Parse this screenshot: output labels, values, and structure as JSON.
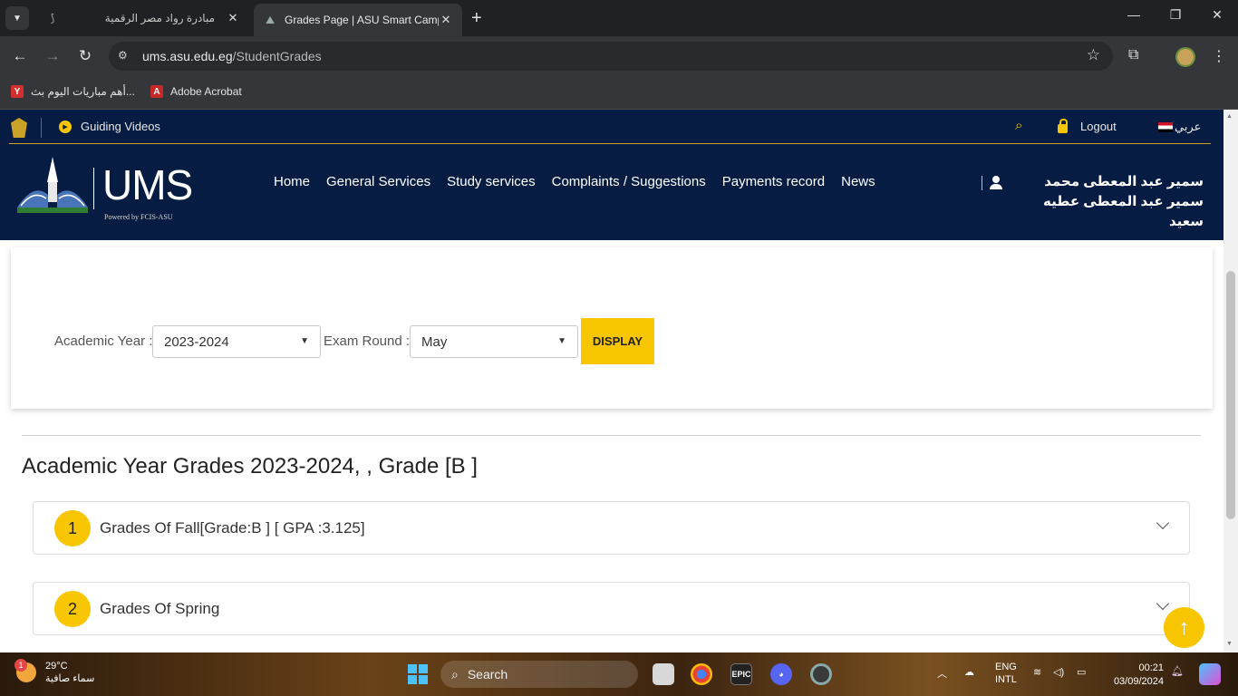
{
  "browser": {
    "tabs": [
      {
        "title": "مبادرة رواد مصر الرقمية",
        "active": false
      },
      {
        "title": "Grades Page | ASU Smart Camp",
        "active": true
      }
    ],
    "url_host": "ums.asu.edu.eg",
    "url_path": "/StudentGrades",
    "bookmarks": [
      {
        "label": "أهم مباريات اليوم بث...",
        "icon": "yalla-icon",
        "color": "#d32f2f"
      },
      {
        "label": "Adobe Acrobat",
        "icon": "acrobat-icon",
        "color": "#d32f2f"
      }
    ]
  },
  "site": {
    "guiding_videos": "Guiding Videos",
    "logout": "Logout",
    "language": "عربي",
    "logo_text": "UMS",
    "logo_powered": "Powered by FCIS-ASU",
    "nav": [
      "Home",
      "General Services",
      "Study services",
      "Complaints / Suggestions",
      "Payments record",
      "News"
    ],
    "user_name": "سمير عبد المعطى محمد سمير عبد المعطى عطيه سعيد"
  },
  "filters": {
    "academic_year_label": "Academic Year :",
    "academic_year_value": "2023-2024",
    "exam_round_label": "Exam Round :",
    "exam_round_value": "May",
    "display_button": "DISPLAY"
  },
  "results": {
    "title": "Academic Year Grades 2023-2024, , Grade [B ]",
    "sections": [
      {
        "number": "1",
        "label": "Grades Of Fall[Grade:B ] [ GPA :3.125]"
      },
      {
        "number": "2",
        "label": "Grades Of Spring"
      }
    ]
  },
  "taskbar": {
    "temperature": "29°C",
    "weather_text": "سماء صافية",
    "weather_badge": "1",
    "search_label": "Search",
    "lang_line1": "ENG",
    "lang_line2": "INTL",
    "time": "00:21",
    "date": "03/09/2024"
  },
  "colors": {
    "navy": "#061c43",
    "accent_yellow": "#f7c600"
  }
}
